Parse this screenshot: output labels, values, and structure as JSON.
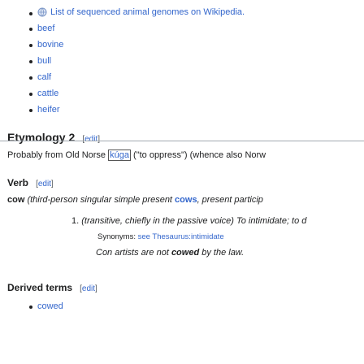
{
  "top_list": {
    "link_text": "List of sequenced animal genomes on Wikipedia.",
    "items": [
      "beef",
      "bovine",
      "bull",
      "calf",
      "cattle",
      "heifer"
    ]
  },
  "etymology": {
    "heading": "Etymology 2",
    "edit_label": "edit",
    "text_before": "Probably from Old Norse ",
    "boxed_word": "kúga",
    "text_after": " (\"to oppress\") (whence also Norw"
  },
  "verb": {
    "heading": "Verb",
    "edit_label": "edit",
    "headword": "cow",
    "inflection_prefix": " (third-person singular simple present ",
    "inflection_word": "cows",
    "inflection_suffix": ", present particip",
    "def_number": "1.",
    "def_text": " (transitive, chiefly in the passive voice) To intimidate; to d",
    "synonyms_label": "Synonyms: ",
    "synonyms_link": "see Thesaurus:intimidate",
    "quote_prefix": "Con artists are not ",
    "quote_bold": "cowed",
    "quote_suffix": " by the law."
  },
  "derived": {
    "heading": "Derived terms",
    "edit_label": "edit",
    "items": [
      "cowed"
    ]
  }
}
